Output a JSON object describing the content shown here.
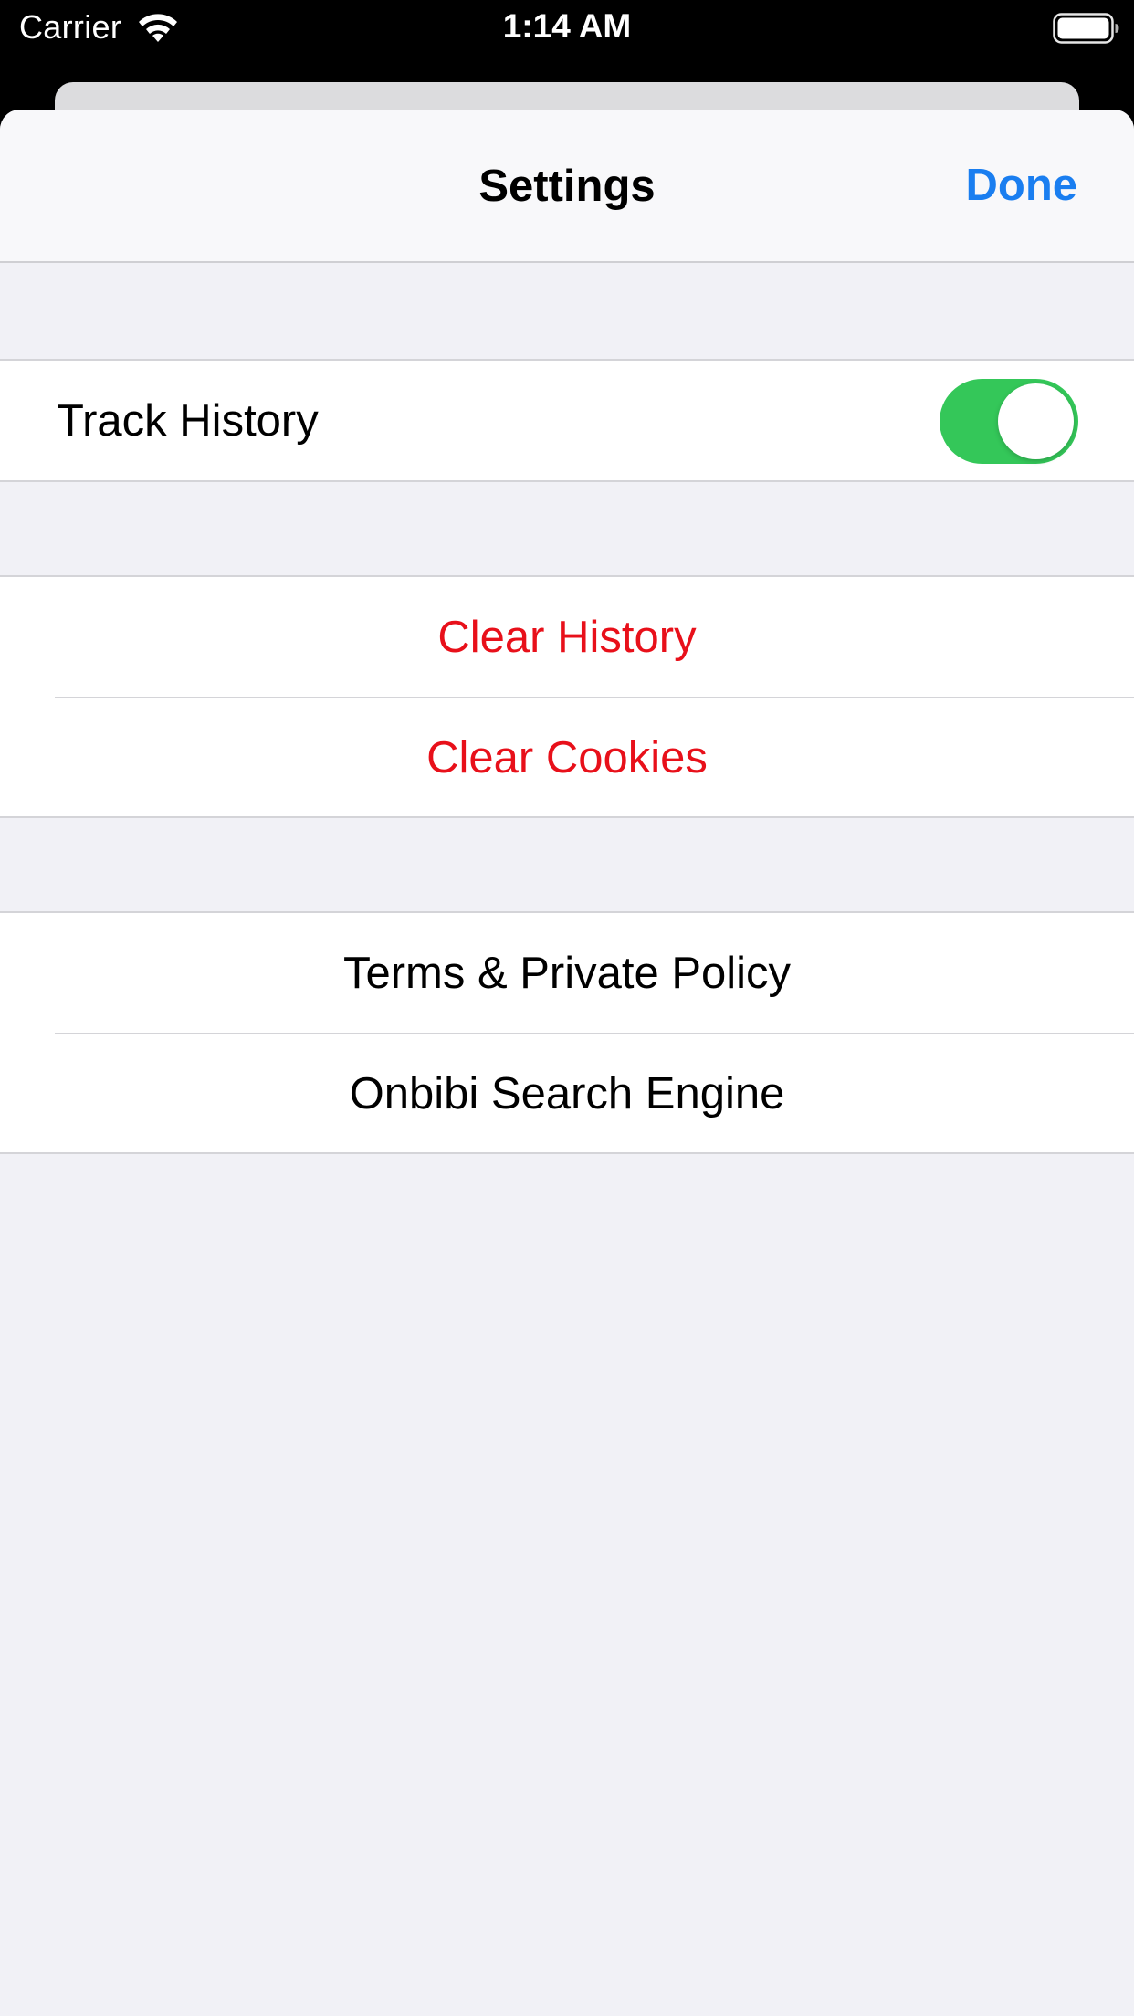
{
  "status_bar": {
    "carrier": "Carrier",
    "time": "1:14 AM",
    "wifi_icon": "wifi-icon",
    "battery_icon": "battery-icon"
  },
  "nav": {
    "title": "Settings",
    "done_label": "Done",
    "accent_color": "#1a7ef0"
  },
  "history_section": {
    "track_history_label": "Track History",
    "track_history_enabled": true,
    "toggle_on_color": "#34c759"
  },
  "clear_section": {
    "clear_history_label": "Clear History",
    "clear_cookies_label": "Clear Cookies",
    "destructive_color": "#e8101a"
  },
  "info_section": {
    "terms_label": "Terms & Private Policy",
    "search_engine_label": "Onbibi Search Engine"
  }
}
